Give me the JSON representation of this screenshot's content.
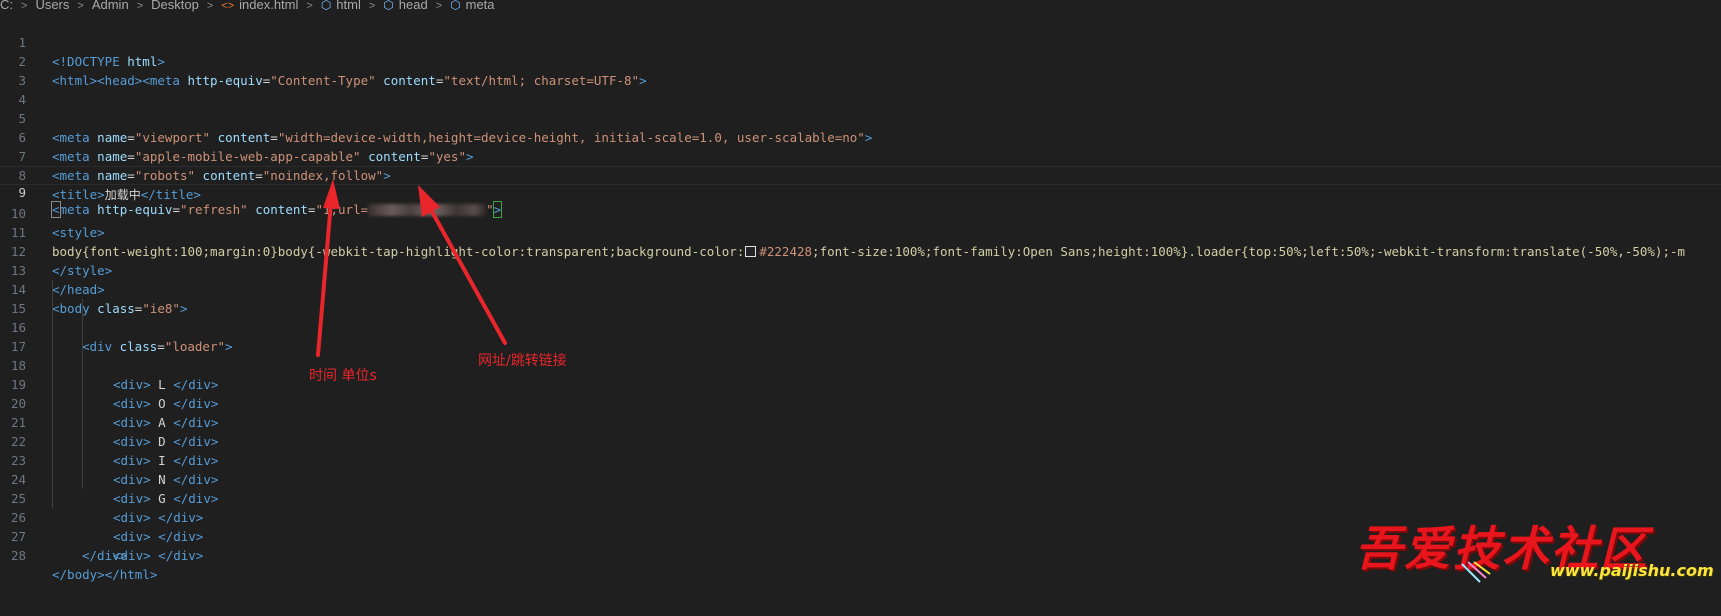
{
  "breadcrumb": {
    "items": [
      {
        "label": "C:"
      },
      {
        "label": "Users"
      },
      {
        "label": "Admin"
      },
      {
        "label": "Desktop"
      },
      {
        "label": "index.html",
        "icon": "html-file-icon"
      },
      {
        "label": "html",
        "icon": "element-cube-icon"
      },
      {
        "label": "head",
        "icon": "element-cube-icon"
      },
      {
        "label": "meta",
        "icon": "element-cube-icon"
      }
    ],
    "separator": ">"
  },
  "editor": {
    "current_line": 9,
    "lines": [
      {
        "n": "1"
      },
      {
        "n": "2"
      },
      {
        "n": "3"
      },
      {
        "n": "4"
      },
      {
        "n": "5"
      },
      {
        "n": "6"
      },
      {
        "n": "7"
      },
      {
        "n": "8"
      },
      {
        "n": "9"
      },
      {
        "n": "10"
      },
      {
        "n": "11"
      },
      {
        "n": "12"
      },
      {
        "n": "13"
      },
      {
        "n": "14"
      },
      {
        "n": "15"
      },
      {
        "n": "16"
      },
      {
        "n": "17"
      },
      {
        "n": "18"
      },
      {
        "n": "19"
      },
      {
        "n": "20"
      },
      {
        "n": "21"
      },
      {
        "n": "22"
      },
      {
        "n": "23"
      },
      {
        "n": "24"
      },
      {
        "n": "25"
      },
      {
        "n": "26"
      },
      {
        "n": "27"
      },
      {
        "n": "28"
      }
    ],
    "tokens": {
      "l1_doctype": "<!DOCTYPE",
      "l1_html": " html",
      "l1_close": ">",
      "l2_html_open": "<html>",
      "l2_head_open": "<head>",
      "l2_meta": "<meta",
      "l2_attr1": " http-equiv",
      "l2_eq1": "=",
      "l2_val1": "\"Content-Type\"",
      "l2_attr2": " content",
      "l2_eq2": "=",
      "l2_val2": "\"text/html; charset=UTF-8\"",
      "l2_end": ">",
      "l5_meta": "<meta",
      "l5_attr1": " name",
      "l5_val1": "\"viewport\"",
      "l5_attr2": " content",
      "l5_val2": "\"width=device-width,height=device-height, initial-scale=1.0, user-scalable=no\"",
      "l5_end": ">",
      "l6_meta": "<meta",
      "l6_attr1": " name",
      "l6_val1": "\"apple-mobile-web-app-capable\"",
      "l6_attr2": " content",
      "l6_val2": "\"yes\"",
      "l6_end": ">",
      "l7_meta": "<meta",
      "l7_attr1": " name",
      "l7_val1": "\"robots\"",
      "l7_attr2": " content",
      "l7_val2": "\"noindex,follow\"",
      "l7_end": ">",
      "l8_open": "<title>",
      "l8_text": "加载中",
      "l8_close": "</title>",
      "l9_lt": "<",
      "l9_meta": "meta",
      "l9_attr1": " http-equiv",
      "l9_val1": "\"refresh\"",
      "l9_attr2": " content",
      "l9_val2a": "\"1;url=",
      "l9_val2b": "\"",
      "l9_gt": ">",
      "l10_style": "<style>",
      "l11_css": "body{font-weight:100;margin:0}body{-webkit-tap-highlight-color:transparent;background-color:",
      "l11_hex": "#222428",
      "l11_css2": ";font-size:100%;font-family:Open Sans;height:100%}.loader{top:50%;left:50%;-webkit-transform:translate(-50%,-50%);-m",
      "l12_style_close": "</style>",
      "l13_head_close": "</head>",
      "l14_body": "<body",
      "l14_attr": " class",
      "l14_val": "\"ie8\"",
      "l14_end": ">",
      "l15_div": "<div",
      "l15_attr": " class",
      "l15_val": "\"loader\"",
      "l15_end": ">",
      "div_open": "<div>",
      "div_close": "</div>",
      "letters": [
        "L",
        "O",
        "A",
        "D",
        "I",
        "N",
        "G"
      ],
      "l27_body_close": "</body>",
      "l27_html_close": "</html>"
    }
  },
  "annotations": {
    "time_label": "时间 单位s",
    "url_label": "网址/跳转链接"
  },
  "watermark": {
    "title": "吾爱技术社区",
    "url": "www.paijishu.com"
  },
  "colors": {
    "background": "#1f1f1f",
    "tag": "#569cd6",
    "attribute": "#9cdcfe",
    "string": "#ce9178",
    "annotation": "#e8262b",
    "watermark_red": "#e8151c",
    "watermark_yellow": "#ffe53b"
  }
}
